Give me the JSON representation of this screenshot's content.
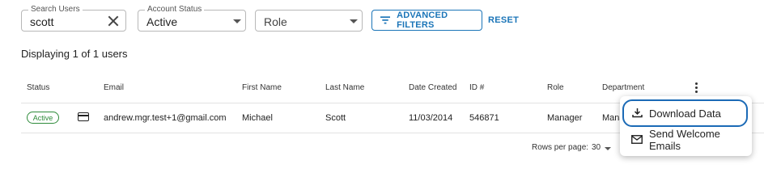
{
  "filters": {
    "search": {
      "label": "Search Users",
      "value": "scott"
    },
    "account_status": {
      "label": "Account Status",
      "value": "Active"
    },
    "role": {
      "placeholder": "Role"
    },
    "advanced_label": "ADVANCED FILTERS",
    "reset_label": "RESET"
  },
  "results": {
    "count_text": "Displaying 1 of 1 users"
  },
  "table": {
    "headers": [
      "Status",
      "Email",
      "First Name",
      "Last Name",
      "Date Created",
      "ID #",
      "Role",
      "Department"
    ],
    "rows": [
      {
        "status": "Active",
        "email": "andrew.mgr.test+1@gmail.com",
        "first_name": "Michael",
        "last_name": "Scott",
        "date_created": "11/03/2014",
        "id": "546871",
        "role": "Manager",
        "department": "Mana"
      }
    ]
  },
  "menu": {
    "items": [
      {
        "label": "Download Data",
        "icon": "download-icon"
      },
      {
        "label": "Send Welcome Emails",
        "icon": "mail-icon"
      }
    ]
  },
  "pagination": {
    "rows_per_page_label": "Rows per page:",
    "rows_per_page_value": "30"
  },
  "colors": {
    "accent": "#1b75b8",
    "status_active": "#2e8b3a",
    "focus_ring": "#1b6ab6"
  }
}
